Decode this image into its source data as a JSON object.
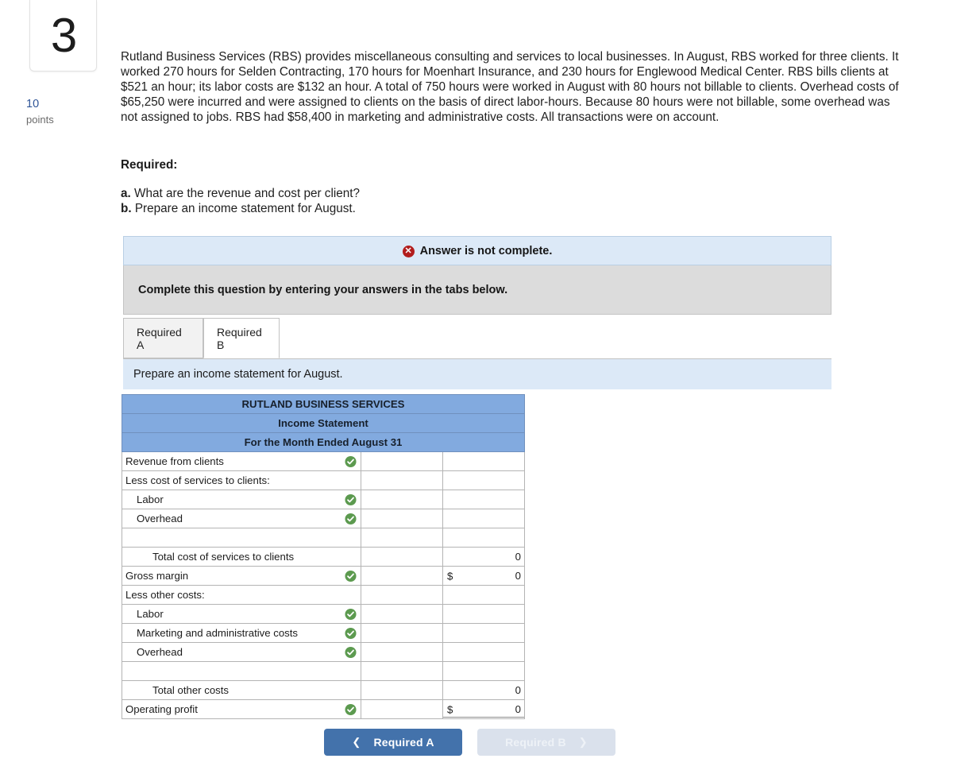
{
  "question": {
    "number": "3",
    "points_value": "10",
    "points_label": "points",
    "stem": "Rutland Business Services (RBS) provides miscellaneous consulting and services to local businesses. In August, RBS worked for three clients. It worked 270 hours for Selden Contracting, 170 hours for Moenhart Insurance, and 230 hours for Englewood Medical Center. RBS bills clients at $521 an hour; its labor costs are $132 an hour. A total of 750 hours were worked in August with 80 hours not billable to clients. Overhead costs of $65,250 were incurred and were assigned to clients on the basis of direct labor-hours. Because 80 hours were not billable, some overhead was not assigned to jobs. RBS had $58,400 in marketing and administrative costs. All transactions were on account.",
    "required_heading": "Required:",
    "requirements": [
      {
        "label": "a.",
        "text": "What are the revenue and cost per client?"
      },
      {
        "label": "b.",
        "text": "Prepare an income statement for August."
      }
    ]
  },
  "banners": {
    "incomplete_icon": "x-circle-icon",
    "incomplete_text": "Answer is not complete.",
    "instruction_text": "Complete this question by entering your answers in the tabs below."
  },
  "tabs": {
    "items": [
      {
        "label": "Required A",
        "active": false
      },
      {
        "label": "Required B",
        "active": true
      }
    ],
    "active_description": "Prepare an income statement for August."
  },
  "statement": {
    "header_lines": [
      "RUTLAND BUSINESS SERVICES",
      "Income Statement",
      "For the Month Ended August 31"
    ],
    "rows": [
      {
        "label": "Revenue from clients",
        "indent": 0,
        "check": true,
        "shaded": true,
        "mid": "",
        "right": "",
        "dollar": ""
      },
      {
        "label": "Less cost of services to clients:",
        "indent": 0,
        "check": false,
        "shaded": true,
        "mid": "",
        "right": "",
        "dollar": ""
      },
      {
        "label": "Labor",
        "indent": 1,
        "check": true,
        "shaded": true,
        "mid": "",
        "right": "",
        "dollar": ""
      },
      {
        "label": "Overhead",
        "indent": 1,
        "check": true,
        "shaded": true,
        "mid": "",
        "right": "",
        "dollar": ""
      },
      {
        "label": "",
        "indent": 0,
        "check": false,
        "shaded": false,
        "mid": "",
        "right": "",
        "dollar": ""
      },
      {
        "label": "Total cost of services to clients",
        "indent": 2,
        "check": false,
        "shaded": false,
        "mid": "",
        "right": "0",
        "dollar": "",
        "topline": true
      },
      {
        "label": "Gross margin",
        "indent": 0,
        "check": true,
        "shaded": true,
        "mid": "",
        "right": "0",
        "dollar": "$",
        "topline_right": true
      },
      {
        "label": "Less other costs:",
        "indent": 0,
        "check": false,
        "shaded": true,
        "mid": "",
        "right": "",
        "dollar": ""
      },
      {
        "label": "Labor",
        "indent": 1,
        "check": true,
        "shaded": true,
        "mid": "",
        "right": "",
        "dollar": ""
      },
      {
        "label": "Marketing and administrative costs",
        "indent": 1,
        "check": true,
        "shaded": true,
        "mid": "",
        "right": "",
        "dollar": ""
      },
      {
        "label": "Overhead",
        "indent": 1,
        "check": true,
        "shaded": true,
        "mid": "",
        "right": "",
        "dollar": ""
      },
      {
        "label": "",
        "indent": 0,
        "check": false,
        "shaded": false,
        "mid": "",
        "right": "",
        "dollar": ""
      },
      {
        "label": "Total other costs",
        "indent": 2,
        "check": false,
        "shaded": false,
        "mid": "",
        "right": "0",
        "dollar": "",
        "topline": true
      },
      {
        "label": "Operating profit",
        "indent": 0,
        "check": true,
        "shaded": true,
        "mid": "",
        "right": "0",
        "dollar": "$",
        "topline_right": true,
        "dblbottom": true
      }
    ],
    "check_icon": "green-check-circle-icon"
  },
  "navigation": {
    "prev": {
      "label": "Required A",
      "icon": "chevron-left-icon",
      "enabled": true
    },
    "next": {
      "label": "Required B",
      "icon": "chevron-right-icon",
      "enabled": false
    }
  },
  "colors": {
    "table_header_blue": "#82aadf",
    "banner_blue": "#dce9f7",
    "banner_gray": "#dcdcdc",
    "check_green": "#5c9a4f",
    "error_red": "#b21d1d",
    "primary_button": "#4372ab",
    "disabled_button": "#dae1ec",
    "points_blue": "#2f5597"
  }
}
